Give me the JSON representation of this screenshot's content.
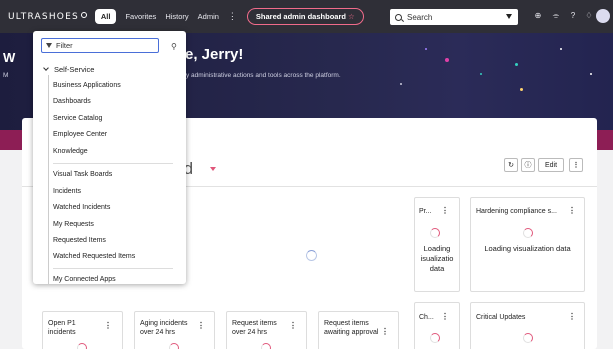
{
  "nav": {
    "logo": "ULTRASHOES",
    "links": [
      "All",
      "Favorites",
      "History",
      "Admin"
    ],
    "more": "⋮",
    "pill_label": "Shared admin dashboard",
    "pill_star": "☆",
    "search_label": "Search"
  },
  "banner": {
    "greeting": "e, Jerry!",
    "greeting_left": "W",
    "subtitle": "y administrative actions and tools across the platform.",
    "subtitle_left": "M"
  },
  "dashboard": {
    "title": "rd",
    "edit_label": "Edit"
  },
  "widgets": {
    "pr_title": "Pr...",
    "hardening_title": "Hardening compliance s...",
    "loading_short": "Loading isualizatio data",
    "loading_long": "Loading visualization data",
    "ch_title": "Ch...",
    "critical_title": "Critical Updates",
    "open_p1": "Open P1 incidents",
    "aging": "Aging incidents over 24 hrs",
    "request_items": "Request items over 24 hrs",
    "request_awaiting": "Request items awaiting approval"
  },
  "dropdown": {
    "filter_placeholder": "Filter",
    "section": "Self-Service",
    "items": [
      "Business Applications",
      "Dashboards",
      "Service Catalog",
      "Employee Center",
      "Knowledge",
      "Visual Task Boards",
      "Incidents",
      "Watched Incidents",
      "My Requests",
      "Requested Items",
      "Watched Requested Items",
      "My Connected Apps"
    ]
  },
  "colors": {
    "nav_bg": "#2f2f37",
    "accent_pink": "#e0567a",
    "band": "#8d1e55",
    "focus_blue": "#4a6fd8"
  }
}
